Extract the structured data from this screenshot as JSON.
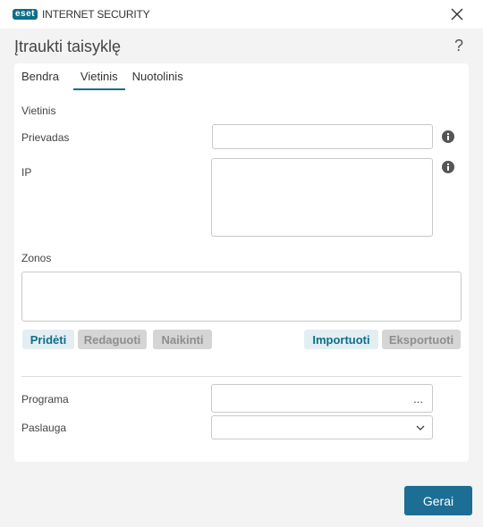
{
  "app": {
    "logo_badge": "eset",
    "logo_text": "INTERNET SECURITY"
  },
  "dialog": {
    "title": "Įtraukti taisyklę",
    "help_symbol": "?"
  },
  "tabs": [
    {
      "label": "Bendra",
      "active": false
    },
    {
      "label": "Vietinis",
      "active": true
    },
    {
      "label": "Nuotolinis",
      "active": false
    }
  ],
  "section": {
    "heading": "Vietinis"
  },
  "fields": {
    "port_label": "Prievadas",
    "port_value": "",
    "ip_label": "IP",
    "ip_value": "",
    "zones_label": "Zonos",
    "program_label": "Programa",
    "program_value": "",
    "program_browse": "...",
    "service_label": "Paslauga",
    "service_value": ""
  },
  "zone_buttons": {
    "add": "Pridėti",
    "edit": "Redaguoti",
    "delete": "Naikinti",
    "import": "Importuoti",
    "export": "Eksportuoti"
  },
  "footer": {
    "ok": "Gerai"
  },
  "colors": {
    "accent": "#0d6e8a",
    "ok_button": "#1c6e95",
    "disabled": "#d5d5d5"
  },
  "icons": [
    "close-icon",
    "help-icon",
    "info-icon",
    "chevron-down-icon"
  ]
}
